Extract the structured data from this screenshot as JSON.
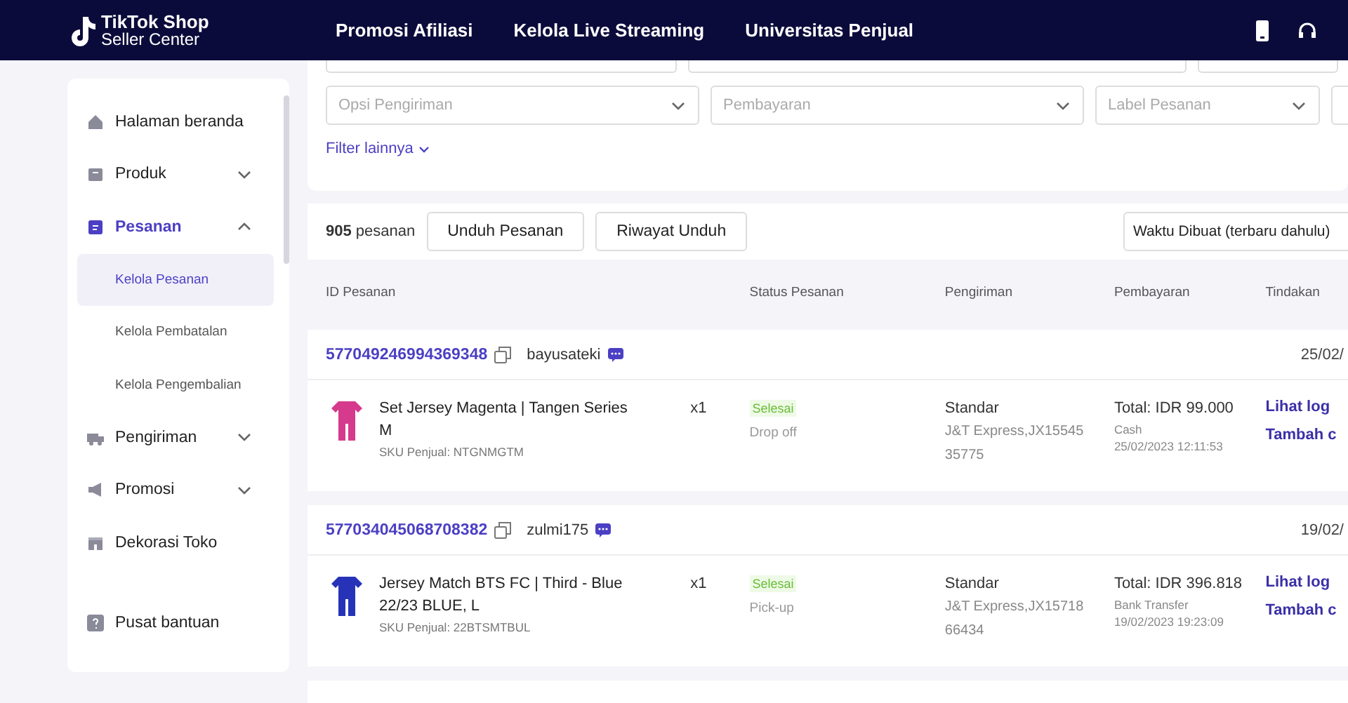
{
  "header": {
    "logo_title": "TikTok Shop",
    "logo_subtitle": "Seller Center",
    "nav": [
      "Promosi Afiliasi",
      "Kelola Live Streaming",
      "Universitas Penjual"
    ]
  },
  "sidebar": {
    "items": [
      {
        "label": "Halaman beranda",
        "selected": false
      },
      {
        "label": "Produk",
        "expanded": false,
        "selected": false
      },
      {
        "label": "Pesanan",
        "expanded": true,
        "selected": true,
        "children": [
          {
            "label": "Kelola Pesanan",
            "selected": true
          },
          {
            "label": "Kelola Pembatalan",
            "selected": false
          },
          {
            "label": "Kelola Pengembalian",
            "selected": false
          }
        ]
      },
      {
        "label": "Pengiriman",
        "expanded": false,
        "selected": false
      },
      {
        "label": "Promosi",
        "expanded": false,
        "selected": false
      },
      {
        "label": "Dekorasi Toko",
        "selected": false
      }
    ],
    "footer_item": {
      "label": "Pusat bantuan"
    }
  },
  "filters": {
    "fields": [
      {
        "placeholder": "Opsi Pengiriman"
      },
      {
        "placeholder": "Pembayaran"
      },
      {
        "placeholder": "Label Pesanan"
      }
    ],
    "more_link": "Filter lainnya"
  },
  "toolbar": {
    "count": "905",
    "count_label": "pesanan",
    "buttons": [
      "Unduh Pesanan",
      "Riwayat Unduh"
    ],
    "sort": "Waktu Dibuat (terbaru dahulu)"
  },
  "table": {
    "columns": [
      "ID Pesanan",
      "Status Pesanan",
      "Pengiriman",
      "Pembayaran",
      "Tindakan"
    ],
    "orders": [
      {
        "id": "577049246994369348",
        "buyer": "bayusateki",
        "date": "25/02/",
        "product": "Set Jersey Magenta | Tangen Series M",
        "sku": "SKU Penjual: NTGNMGTM",
        "qty": "x1",
        "status": "Selesai",
        "status_note": "Drop off",
        "shipping": "Standar",
        "carrier": "J&T Express,JX1554535775",
        "total": "Total: IDR 99.000",
        "method": "Cash",
        "paid_at": "25/02/2023 12:11:53",
        "actions": [
          "Lihat log",
          "Tambah c"
        ]
      },
      {
        "id": "577034045068708382",
        "buyer": "zulmi175",
        "date": "19/02/",
        "product": "Jersey Match BTS FC | Third - Blue 22/23 BLUE, L",
        "sku": "SKU Penjual: 22BTSMTBUL",
        "qty": "x1",
        "status": "Selesai",
        "status_note": "Pick-up",
        "shipping": "Standar",
        "carrier": "J&T Express,JX1571866434",
        "total": "Total: IDR 396.818",
        "method": "Bank Transfer",
        "paid_at": "19/02/2023 19:23:09",
        "actions": [
          "Lihat log",
          "Tambah c"
        ]
      }
    ]
  }
}
